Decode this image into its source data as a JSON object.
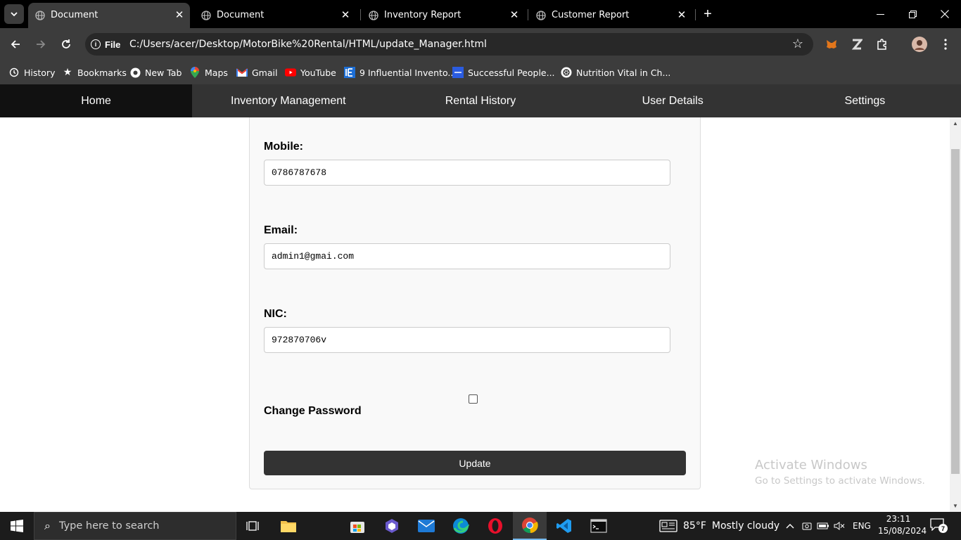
{
  "browser": {
    "tabs": [
      {
        "title": "Document",
        "active": true
      },
      {
        "title": "Document",
        "active": false
      },
      {
        "title": "Inventory Report",
        "active": false
      },
      {
        "title": "Customer Report",
        "active": false
      }
    ],
    "new_tab_label": "+",
    "omnibox": {
      "scheme_label": "File",
      "url": "C:/Users/acer/Desktop/MotorBike%20Rental/HTML/update_Manager.html"
    },
    "bookmarks": [
      {
        "label": "History",
        "icon": "history-icon"
      },
      {
        "label": "Bookmarks",
        "icon": "star-icon"
      },
      {
        "label": "New Tab",
        "icon": "chrome-icon"
      },
      {
        "label": "Maps",
        "icon": "maps-icon"
      },
      {
        "label": "Gmail",
        "icon": "gmail-icon"
      },
      {
        "label": "YouTube",
        "icon": "youtube-icon"
      },
      {
        "label": "9 Influential Invento...",
        "icon": "ie-icon"
      },
      {
        "label": "Successful People...",
        "icon": "blue-square-icon"
      },
      {
        "label": "Nutrition Vital in Ch...",
        "icon": "openai-icon"
      }
    ]
  },
  "nav": {
    "items": [
      "Home",
      "Inventory Management",
      "Rental History",
      "User Details",
      "Settings"
    ],
    "active_index": 0
  },
  "form": {
    "mobile": {
      "label": "Mobile:",
      "value": "0786787678"
    },
    "email": {
      "label": "Email:",
      "value": "admin1@gmai.com"
    },
    "nic": {
      "label": "NIC:",
      "value": "972870706v"
    },
    "change_password": {
      "label": "Change Password",
      "checked": false
    },
    "update_button": "Update"
  },
  "watermark": {
    "line1": "Activate Windows",
    "line2": "Go to Settings to activate Windows."
  },
  "taskbar": {
    "search_placeholder": "Type here to search",
    "weather": {
      "temp": "85°F",
      "condition": "Mostly cloudy"
    },
    "language": "ENG",
    "time": "23:11",
    "date": "15/08/2024",
    "notification_count": "7"
  },
  "colors": {
    "nav_bg": "#333333",
    "nav_active": "#111111",
    "button_bg": "#333333",
    "card_bg": "#f9f9f9"
  }
}
